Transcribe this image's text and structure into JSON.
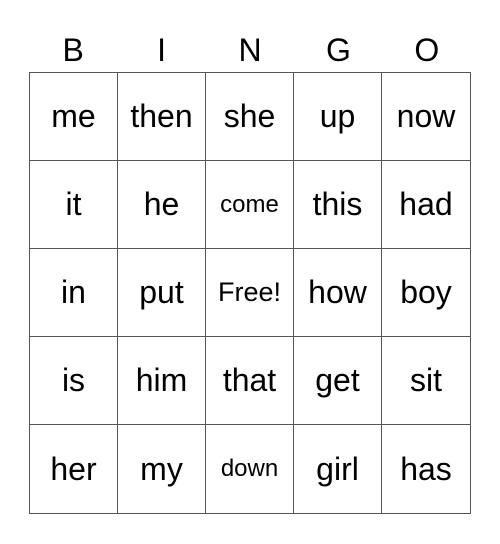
{
  "header": [
    "B",
    "I",
    "N",
    "G",
    "O"
  ],
  "rows": [
    [
      "me",
      "then",
      "she",
      "up",
      "now"
    ],
    [
      "it",
      "he",
      "come",
      "this",
      "had"
    ],
    [
      "in",
      "put",
      "Free!",
      "how",
      "boy"
    ],
    [
      "is",
      "him",
      "that",
      "get",
      "sit"
    ],
    [
      "her",
      "my",
      "down",
      "girl",
      "has"
    ]
  ]
}
